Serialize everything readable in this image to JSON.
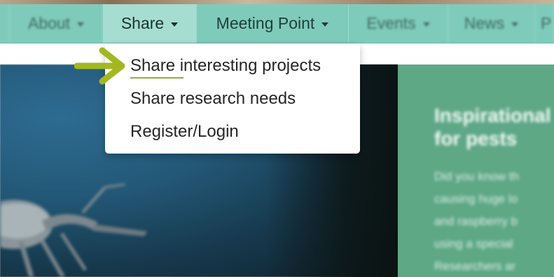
{
  "navbar": {
    "items": [
      {
        "label": ""
      },
      {
        "label": "About"
      },
      {
        "label": "Share"
      },
      {
        "label": "Meeting Point"
      },
      {
        "label": "Events"
      },
      {
        "label": "News"
      },
      {
        "label": "P"
      }
    ]
  },
  "dropdown": {
    "items": [
      {
        "label": "Share interesting projects"
      },
      {
        "label": "Share research needs"
      },
      {
        "label": "Register/Login"
      }
    ]
  },
  "hero": {
    "title": "Inspirational\nfor pests",
    "text": "Did you know th\ncausing huge lo\nand raspberry b\nusing a special\nResearchers ar"
  },
  "colors": {
    "navbar": "#7fcbbb",
    "active_tab": "#a6ddd1",
    "hero_panel": "#5ea886",
    "arrow": "#a3b820"
  },
  "icons": {
    "caret": "chevron-down-icon",
    "pointer": "pointer-arrow-icon"
  }
}
